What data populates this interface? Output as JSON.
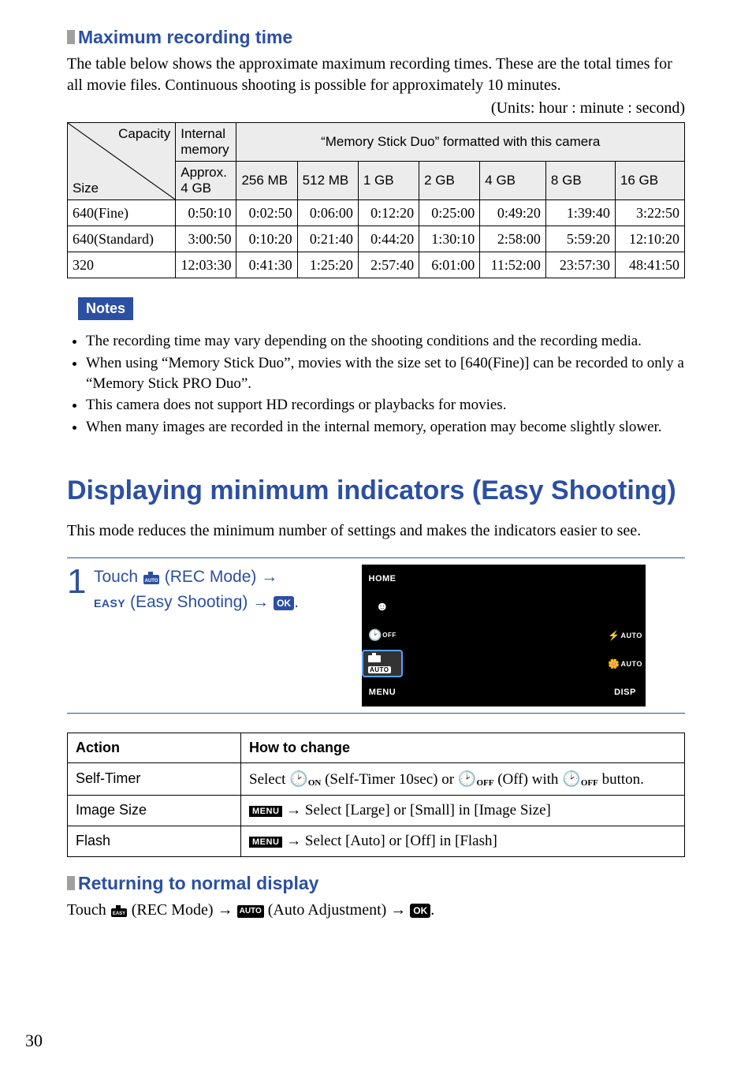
{
  "page_number": "30",
  "heading_max_rec": "Maximum recording time",
  "intro_paragraph": "The table below shows the approximate maximum recording times. These are the total times for all movie files. Continuous shooting is possible for approximately 10 minutes.",
  "units_line": "(Units: hour : minute : second)",
  "table1": {
    "diag": {
      "capacity": "Capacity",
      "size": "Size"
    },
    "internal_header": "Internal memory",
    "internal_sub": "Approx. 4 GB",
    "memstick_header": "“Memory Stick Duo” formatted with this camera",
    "capacities": [
      "256 MB",
      "512 MB",
      "1 GB",
      "2 GB",
      "4 GB",
      "8 GB",
      "16 GB"
    ],
    "rows": [
      {
        "label": "640(Fine)",
        "internal": "0:50:10",
        "values": [
          "0:02:50",
          "0:06:00",
          "0:12:20",
          "0:25:00",
          "0:49:20",
          "1:39:40",
          "3:22:50"
        ]
      },
      {
        "label": "640(Standard)",
        "internal": "3:00:50",
        "values": [
          "0:10:20",
          "0:21:40",
          "0:44:20",
          "1:30:10",
          "2:58:00",
          "5:59:20",
          "12:10:20"
        ]
      },
      {
        "label": "320",
        "internal": "12:03:30",
        "values": [
          "0:41:30",
          "1:25:20",
          "2:57:40",
          "6:01:00",
          "11:52:00",
          "23:57:30",
          "48:41:50"
        ]
      }
    ]
  },
  "notes_label": "Notes",
  "notes": [
    "The recording time may vary depending on the shooting conditions and the recording media.",
    "When using “Memory Stick Duo”, movies with the size set to [640(Fine)] can be recorded to only a “Memory Stick PRO Duo”.",
    "This camera does not support HD recordings or playbacks for movies.",
    "When many images are recorded in the internal memory, operation may become slightly slower."
  ],
  "heading_easy": "Displaying minimum indicators (Easy Shooting)",
  "easy_intro": "This mode reduces the minimum number of settings and makes the indicators easier to see.",
  "step": {
    "num": "1",
    "line1_pre": "Touch ",
    "line1_icon": "rec-mode-icon",
    "line1_post": " (REC Mode) ",
    "arrow": "→",
    "line2_easy": "EASY",
    "line2_rest": " (Easy Shooting) ",
    "ok": "OK",
    "dot": "."
  },
  "lcd": {
    "home": "HOME",
    "menu": "MENU",
    "disp": "DISP",
    "flash_auto": "AUTO",
    "macro_auto": "AUTO",
    "off_suffix": "OFF",
    "auto_badge": "AUTO"
  },
  "actions_table": {
    "headers": [
      "Action",
      "How to change"
    ],
    "rows": [
      {
        "action": "Self-Timer",
        "how_pre": "Select ",
        "how_a_sub": "ON",
        "how_a_post": " (Self-Timer 10sec) or ",
        "how_b_sub": "OFF",
        "how_b_post": " (Off) with ",
        "how_c_sub": "OFF",
        "how_end": " button."
      },
      {
        "action": "Image Size",
        "menu": "MENU",
        "arrow": " → ",
        "rest": "Select [Large] or [Small] in [Image Size]"
      },
      {
        "action": "Flash",
        "menu": "MENU",
        "arrow": " → ",
        "rest": "Select [Auto] or [Off] in [Flash]"
      }
    ]
  },
  "heading_return": "Returning to normal display",
  "return_line": {
    "pre": "Touch ",
    "mid1": " (REC Mode) ",
    "arrow": "→",
    "mid2": " (Auto Adjustment) ",
    "ok": "OK",
    "dot": "."
  }
}
